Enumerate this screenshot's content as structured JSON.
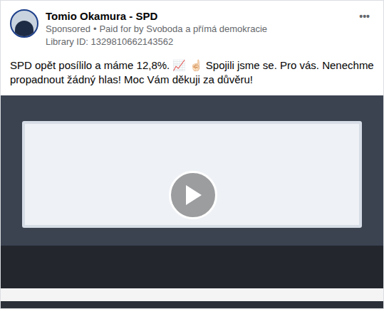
{
  "post": {
    "author": "Tomio Okamura - SPD",
    "sponsored_label": "Sponsored",
    "separator": "•",
    "paid_by": "Paid for by Svoboda a přímá demokracie",
    "library_id": "Library ID: 1329810662143562",
    "menu": "•••",
    "text": "SPD opět posílilo a máme 12,8%. 📈 ☝🏻 Spojili jsme se. Pro vás. Nenechme propadnout žádný hlas! Moc Vám děkuji za důvěru!"
  },
  "video": {
    "playing": false
  }
}
